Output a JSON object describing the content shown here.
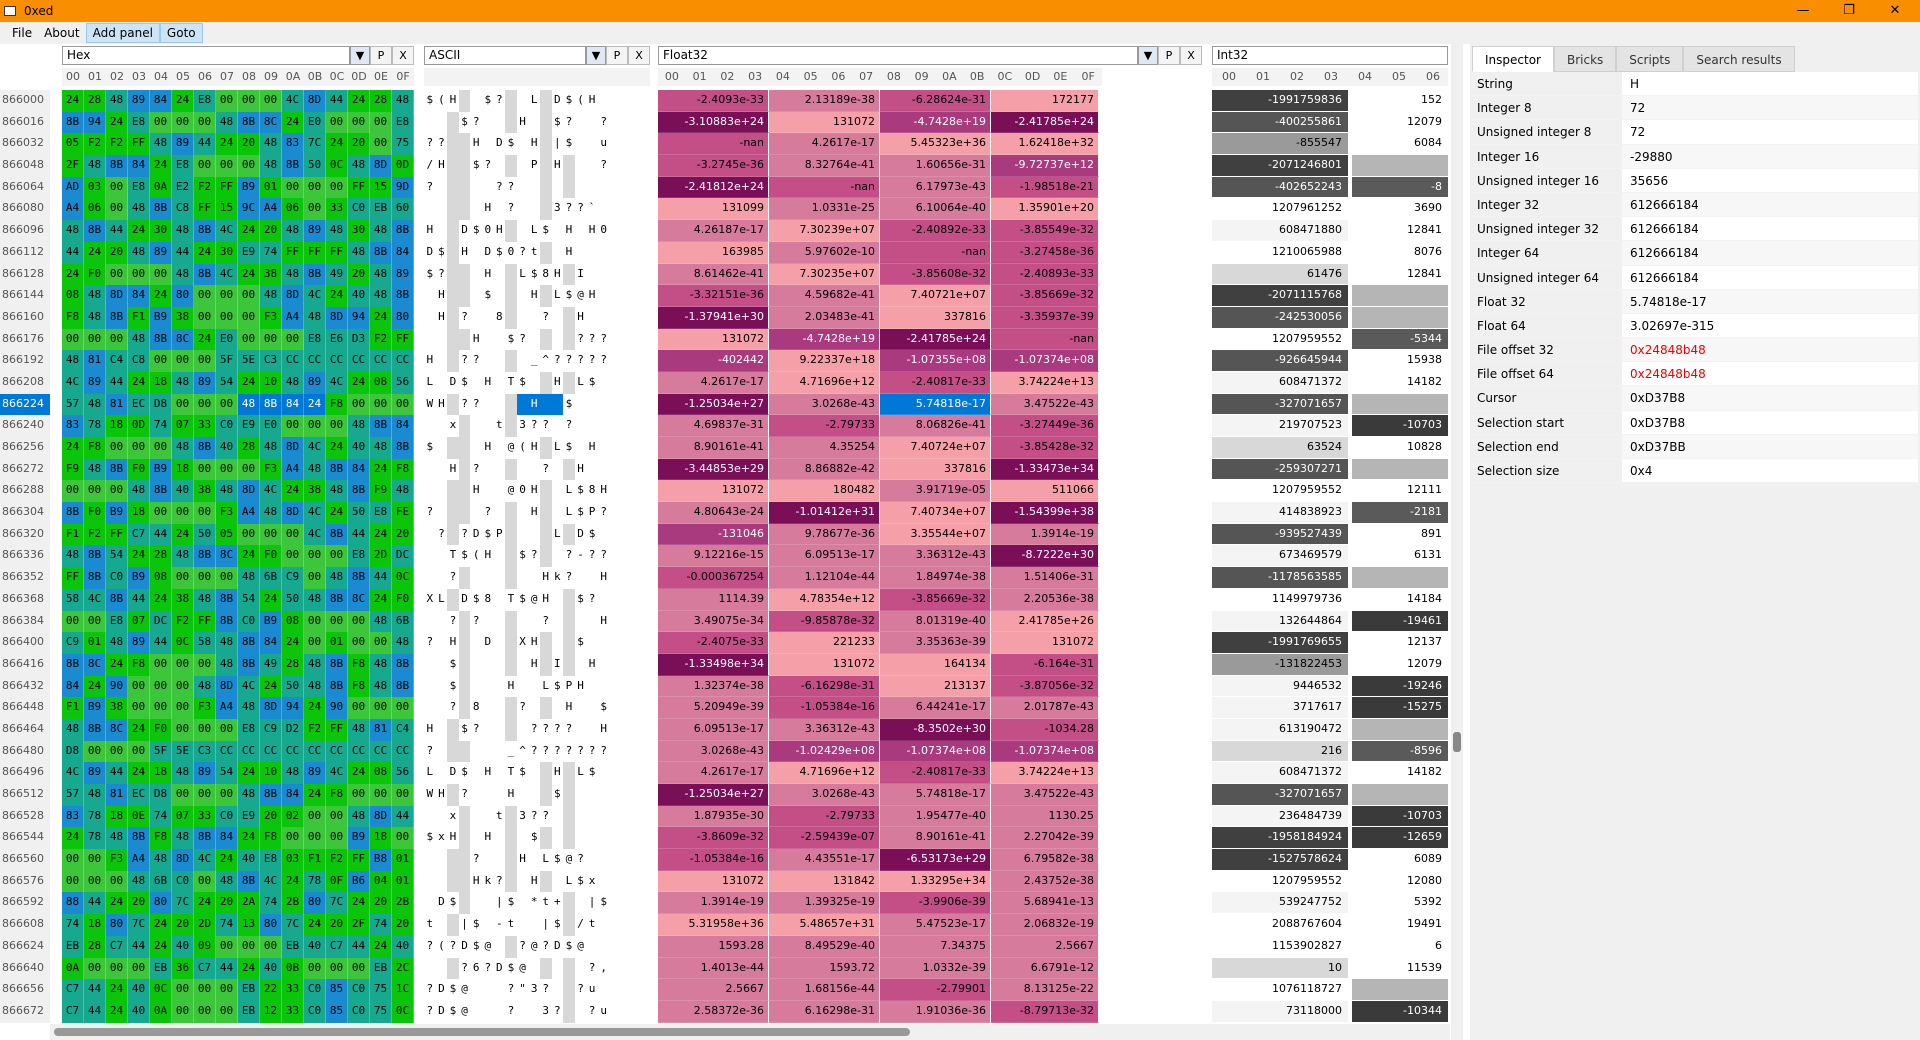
{
  "window": {
    "title": "0xed",
    "icon": "app-icon",
    "minimize": "—",
    "maximize": "❐",
    "close": "✕"
  },
  "menu": [
    "File",
    "About",
    "Add panel",
    "Goto"
  ],
  "offsets": [
    "866000",
    "866016",
    "866032",
    "866048",
    "866064",
    "866080",
    "866096",
    "866112",
    "866128",
    "866144",
    "866160",
    "866176",
    "866192",
    "866208",
    "866224",
    "866240",
    "866256",
    "866272",
    "866288",
    "866304",
    "866320",
    "866336",
    "866352",
    "866368",
    "866384",
    "866400",
    "866416",
    "866432",
    "866448",
    "866464",
    "866480",
    "866496",
    "866512",
    "866528",
    "866544",
    "866560",
    "866576",
    "866592",
    "866608",
    "866624",
    "866640",
    "866656",
    "866672"
  ],
  "selected_offset": "866224",
  "colors": {
    "accent": "#f88e00",
    "selection": "#0078d7",
    "float_palette": [
      "#7a0f58",
      "#a83a7d",
      "#c44f86",
      "#d67b9c",
      "#f5a0a8"
    ],
    "hex_palette": [
      "#1a8bd1",
      "#16a98f",
      "#3cc63a",
      "#0bc50b",
      "#0058d0"
    ]
  },
  "hex_panel": {
    "name": "Hex",
    "cols": [
      "00",
      "01",
      "02",
      "03",
      "04",
      "05",
      "06",
      "07",
      "08",
      "09",
      "0A",
      "0B",
      "0C",
      "0D",
      "0E",
      "0F"
    ],
    "rows": [
      "24 28 48 89 84 24 E8 00 00 00 4C 8D 44 24 28 48",
      "8B 94 24 E8 00 00 00 48 8B 8C 24 E0 00 00 00 E8",
      "05 F2 F2 FF 48 89 44 24 20 48 83 7C 24 20 00 75",
      "2F 48 8B 84 24 E8 00 00 00 48 8B 50 0C 48 8D 0D",
      "AD 03 00 E8 0A E2 F2 FF B9 01 00 00 00 FF 15 9D",
      "A4 06 00 48 8B C8 FF 15 9C A4 06 00 33 C0 EB 60",
      "48 8B 44 24 30 48 8B 4C 24 20 48 89 48 30 48 8B",
      "44 24 20 48 89 44 24 30 E9 74 FF FF FF 48 8B 84",
      "24 F0 00 00 00 48 8B 4C 24 38 48 8B 49 20 48 89",
      "08 48 8D 84 24 80 00 00 00 48 8D 4C 24 40 48 8B",
      "F8 48 8B F1 B9 38 00 00 00 F3 A4 48 8D 94 24 80",
      "00 00 00 48 8B 8C 24 E0 00 00 00 E8 E6 D3 F2 FF",
      "48 81 C4 C8 00 00 00 5F 5E C3 CC CC CC CC CC CC",
      "4C 89 44 24 18 48 89 54 24 10 48 89 4C 24 08 56",
      "57 48 81 EC D8 00 00 00 48 8B 84 24 F8 00 00 00",
      "83 78 18 0D 74 07 33 C0 E9 E0 00 00 00 48 8B 84",
      "24 F8 00 00 00 48 8B 40 28 48 8D 4C 24 40 48 8B",
      "F9 48 8B F0 B9 18 00 00 00 F3 A4 48 8B 84 24 F8",
      "00 00 00 48 8B 40 38 48 8D 4C 24 38 48 8B F9 48",
      "8B F0 B9 18 00 00 00 F3 A4 48 8D 4C 24 50 E8 FE",
      "F1 F2 FF C7 44 24 50 05 00 00 00 4C 8B 44 24 20",
      "48 8B 54 24 28 48 8B 8C 24 F0 00 00 00 E8 2D DC",
      "FF 8B C0 B9 08 00 00 00 48 6B C9 00 48 8B 44 0C",
      "58 4C 8B 44 24 38 48 8B 54 24 50 48 8B 8C 24 F0",
      "00 00 E8 07 DC F2 FF 8B C0 B9 08 00 00 00 48 6B",
      "C9 01 48 89 44 0C 58 48 8B 84 24 00 01 00 00 48",
      "8B 8C 24 F8 00 00 00 48 8B 49 28 48 8B F8 48 8B",
      "84 24 90 00 00 00 48 8D 4C 24 50 48 8B F8 48 8B",
      "F1 B9 38 00 00 00 F3 A4 48 8D 94 24 90 00 00 00",
      "48 8B 8C 24 F0 00 00 00 E8 C9 D2 F2 FF 48 81 C4",
      "D8 00 00 00 5F 5E C3 CC CC CC CC CC CC CC CC CC",
      "4C 89 44 24 18 48 89 54 24 10 48 89 4C 24 08 56",
      "57 48 81 EC D8 00 00 00 48 8B 84 24 F8 00 00 00",
      "83 78 18 0E 74 07 33 C0 E9 20 02 00 00 48 8D 44",
      "24 78 48 8B F8 48 8B 84 24 F8 00 00 00 B9 18 00",
      "00 00 F3 A4 48 8D 4C 24 40 E8 03 F1 F2 FF B8 01",
      "00 00 00 48 6B C0 00 48 8B 4C 24 78 0F B6 04 01",
      "88 44 24 20 80 7C 24 20 2A 74 2B 80 7C 24 20 2B",
      "74 18 80 7C 24 20 2D 74 13 80 7C 24 20 2F 74 20",
      "EB 28 C7 44 24 40 09 00 00 00 EB 40 C7 44 24 40",
      "0A 00 00 00 EB 36 C7 44 24 40 0B 00 00 00 EB 2C",
      "C7 44 24 40 0C 00 00 00 EB 22 33 C0 85 C0 75 1C",
      "C7 44 24 40 0A 00 00 00 EB 12 33 C0 85 C0 75 0C"
    ]
  },
  "ascii_panel": {
    "name": "ASCII",
    "rows": [
      "$(H  $?  L D$(H",
      "   $?   H  $?  ?",
      "??  H D$ H |$  u",
      "/H  $?   P H   ?",
      "?     ??        ",
      "     H ?   3??`",
      "H  D$0H  L$ H H0H",
      "D$ H D$0?t  H   ",
      "$?   H  L$8H I  H",
      " H   $   H L$@H",
      " H ?  8   ?  H  $",
      "    H  $?    ????",
      "H  ??    _^??????",
      "L D$ H T$  H L$ V",
      "WH ??    H  $   ",
      "  x   t 3?? ?   H",
      "$    H @(H L$ H",
      "  H ?     ?  H  $",
      "    H  @0H  L$8H  H",
      "?    ?   H  L$P?",
      " ? ?D$P    L D$",
      "  T$(H  $?  ?-??",
      "  ?       Hk?  H D",
      "XL D$8 T$@H  $?",
      "  ? ?     ?    Hk",
      "? H  D  XH   $",
      "  $      H I  H",
      "  $    H  L$PH  H",
      "  ? 8   ?   H  $",
      "H  $?    ????  H ?",
      "?      _^???????",
      "L D$ H T$  H L$ V",
      "WH ?   H   $   ",
      "  x   t 3??     H D",
      "$xH  H   $",
      "    ?   H L$@?   ?",
      "    Hk?  H  L$x",
      " D$   |$ *t+  |$ +",
      "t  |$ -t  |$ /t",
      "?(?D$@  ?@?D$@",
      "   ?6?D$@     ?,",
      "?D$@   ?\"3?  ?u",
      "?D$@   ?  3?  ?u"
    ]
  },
  "float_panel": {
    "name": "Float32",
    "cols": [
      "00",
      "01",
      "02",
      "03",
      "04",
      "05",
      "06",
      "07",
      "08",
      "09",
      "0A",
      "0B",
      "0C",
      "0D",
      "0E",
      "0F"
    ],
    "rows": [
      [
        "-2.4093e-33",
        "2.13189e-38",
        "-6.28624e-31",
        "172177"
      ],
      [
        "-3.10883e+24",
        "131072",
        "-4.7428e+19",
        "-2.41785e+24"
      ],
      [
        "-nan",
        "4.2617e-17",
        "5.45323e+36",
        "1.62418e+32"
      ],
      [
        "-3.2745e-36",
        "8.32764e-41",
        "1.60656e-31",
        "-9.72737e+12"
      ],
      [
        "-2.41812e+24",
        "-nan",
        "6.17973e-43",
        "-1.98518e-21"
      ],
      [
        "131099",
        "1.0331e-25",
        "6.10064e-40",
        "1.35901e+20"
      ],
      [
        "4.26187e-17",
        "7.30239e+07",
        "-2.40892e-33",
        "-3.85549e-32"
      ],
      [
        "163985",
        "5.97602e-10",
        "-nan",
        "-3.27458e-36"
      ],
      [
        "8.61462e-41",
        "7.30235e+07",
        "-3.85608e-32",
        "-2.40893e-33"
      ],
      [
        "-3.32151e-36",
        "4.59682e-41",
        "7.40721e+07",
        "-3.85669e-32"
      ],
      [
        "-1.37941e+30",
        "2.03483e-41",
        "337816",
        "-3.35937e-39"
      ],
      [
        "131072",
        "-4.7428e+19",
        "-2.41785e+24",
        "-nan"
      ],
      [
        "-402442",
        "9.22337e+18",
        "-1.07355e+08",
        "-1.07374e+08"
      ],
      [
        "4.2617e-17",
        "4.71696e+12",
        "-2.40817e-33",
        "3.74224e+13"
      ],
      [
        "-1.25034e+27",
        "3.0268e-43",
        "5.74818e-17",
        "3.47522e-43"
      ],
      [
        "4.69837e-31",
        "-2.79733",
        "8.06826e-41",
        "-3.27449e-36"
      ],
      [
        "8.90161e-41",
        "4.35254",
        "7.40724e+07",
        "-3.85428e-32"
      ],
      [
        "-3.44853e+29",
        "8.86882e-42",
        "337816",
        "-1.33473e+34"
      ],
      [
        "131072",
        "180482",
        "3.91719e-05",
        "511066"
      ],
      [
        "4.80643e-24",
        "-1.01412e+31",
        "7.40734e+07",
        "-1.54399e+38"
      ],
      [
        "-131046",
        "9.78677e-36",
        "3.35544e+07",
        "1.3914e-19"
      ],
      [
        "9.12216e-15",
        "6.09513e-17",
        "3.36312e-43",
        "-8.7222e+30"
      ],
      [
        "-0.000367254",
        "1.12104e-44",
        "1.84974e-38",
        "1.51406e-31"
      ],
      [
        "1114.39",
        "4.78354e+12",
        "-3.85669e-32",
        "2.20536e-38"
      ],
      [
        "3.49075e-34",
        "-9.85878e-32",
        "8.01319e-40",
        "2.41785e+26"
      ],
      [
        "-2.4075e-33",
        "221233",
        "3.35363e-39",
        "131072"
      ],
      [
        "-1.33498e+34",
        "131072",
        "164134",
        "-6.164e-31"
      ],
      [
        "1.32374e-38",
        "-6.16298e-31",
        "213137",
        "-3.87056e-32"
      ],
      [
        "5.20949e-39",
        "-1.05384e-16",
        "6.44241e-17",
        "2.01787e-43"
      ],
      [
        "6.09513e-17",
        "3.36312e-43",
        "-8.3502e+30",
        "-1034.28"
      ],
      [
        "3.0268e-43",
        "-1.02429e+08",
        "-1.07374e+08",
        "-1.07374e+08"
      ],
      [
        "4.2617e-17",
        "4.71696e+12",
        "-2.40817e-33",
        "3.74224e+13"
      ],
      [
        "-1.25034e+27",
        "3.0268e-43",
        "5.74818e-17",
        "3.47522e-43"
      ],
      [
        "1.87935e-30",
        "-2.79733",
        "1.95477e-40",
        "1130.25"
      ],
      [
        "-3.8609e-32",
        "-2.59439e-07",
        "8.90161e-41",
        "2.27042e-39"
      ],
      [
        "-1.05384e-16",
        "4.43551e-17",
        "-6.53173e+29",
        "6.79582e-38"
      ],
      [
        "131072",
        "131842",
        "1.33295e+34",
        "2.43752e-38"
      ],
      [
        "1.3914e-19",
        "1.39325e-19",
        "-3.9906e-39",
        "5.68941e-13"
      ],
      [
        "5.31958e+36",
        "5.48657e+31",
        "5.47523e-17",
        "2.06832e-19"
      ],
      [
        "1593.28",
        "8.49529e-40",
        "7.34375",
        "2.5667"
      ],
      [
        "1.4013e-44",
        "1593.72",
        "1.0332e-39",
        "6.6791e-12"
      ],
      [
        "2.5667",
        "1.68156e-44",
        "-2.79901",
        "8.13125e-22"
      ],
      [
        "2.58372e-36",
        "6.16298e-31",
        "1.91036e-36",
        "-8.79713e-32"
      ]
    ]
  },
  "int32_panel": {
    "name": "Int32",
    "cols": [
      "00",
      "01",
      "02",
      "03",
      "04",
      "05",
      "06"
    ],
    "rows": [
      [
        "-1991759836",
        "152"
      ],
      [
        "-400255861",
        "12079"
      ],
      [
        "-855547",
        "6084"
      ],
      [
        "-2071246801",
        ""
      ],
      [
        "-402652243",
        "-8"
      ],
      [
        "1207961252",
        "3690"
      ],
      [
        "608471880",
        "12841"
      ],
      [
        "1210065988",
        "8076"
      ],
      [
        "61476",
        "12841"
      ],
      [
        "-2071115768",
        ""
      ],
      [
        "-242530056",
        ""
      ],
      [
        "1207959552",
        "-5344"
      ],
      [
        "-926645944",
        "15938"
      ],
      [
        "608471372",
        "14182"
      ],
      [
        "-327071657",
        ""
      ],
      [
        "219707523",
        "-10703"
      ],
      [
        "63524",
        "10828"
      ],
      [
        "-259307271",
        ""
      ],
      [
        "1207959552",
        "12111"
      ],
      [
        "414838923",
        "-2181"
      ],
      [
        "-939527439",
        "891"
      ],
      [
        "673469579",
        "6131"
      ],
      [
        "-1178563585",
        ""
      ],
      [
        "1149979736",
        "14184"
      ],
      [
        "132644864",
        "-19461"
      ],
      [
        "-1991769655",
        "12137"
      ],
      [
        "-131822453",
        "12079"
      ],
      [
        "9446532",
        "-19246"
      ],
      [
        "3717617",
        "-15275"
      ],
      [
        "613190472",
        ""
      ],
      [
        "216",
        "-8596"
      ],
      [
        "608471372",
        "14182"
      ],
      [
        "-327071657",
        ""
      ],
      [
        "236484739",
        "-10703"
      ],
      [
        "-1958184924",
        "-12659"
      ],
      [
        "-1527578624",
        "6089"
      ],
      [
        "1207959552",
        "12080"
      ],
      [
        "539247752",
        "5392"
      ],
      [
        "2088767604",
        "19491"
      ],
      [
        "1153902827",
        "6"
      ],
      [
        "10",
        "11539"
      ],
      [
        "1076118727",
        ""
      ],
      [
        "73118000",
        "-10344"
      ]
    ]
  },
  "panel_buttons": {
    "dropdown": "▼",
    "pin": "P",
    "close": "X"
  },
  "inspector": {
    "tabs": [
      "Inspector",
      "Bricks",
      "Scripts",
      "Search results"
    ],
    "rows": [
      {
        "k": "String",
        "v": "H"
      },
      {
        "k": "Integer 8",
        "v": "72"
      },
      {
        "k": "Unsigned integer 8",
        "v": "72"
      },
      {
        "k": "Integer 16",
        "v": "-29880"
      },
      {
        "k": "Unsigned integer 16",
        "v": "35656"
      },
      {
        "k": "Integer 32",
        "v": "612666184"
      },
      {
        "k": "Unsigned integer 32",
        "v": "612666184"
      },
      {
        "k": "Integer 64",
        "v": "612666184"
      },
      {
        "k": "Unsigned integer 64",
        "v": "612666184"
      },
      {
        "k": "Float 32",
        "v": "5.74818e-17"
      },
      {
        "k": "Float 64",
        "v": "3.02697e-315"
      },
      {
        "k": "File offset 32",
        "v": "0x24848b48",
        "red": true
      },
      {
        "k": "File offset 64",
        "v": "0x24848b48",
        "red": true
      },
      {
        "k": "Cursor",
        "v": "0xD37B8"
      },
      {
        "k": "Selection start",
        "v": "0xD37B8"
      },
      {
        "k": "Selection end",
        "v": "0xD37BB"
      },
      {
        "k": "Selection size",
        "v": "0x4"
      }
    ]
  }
}
